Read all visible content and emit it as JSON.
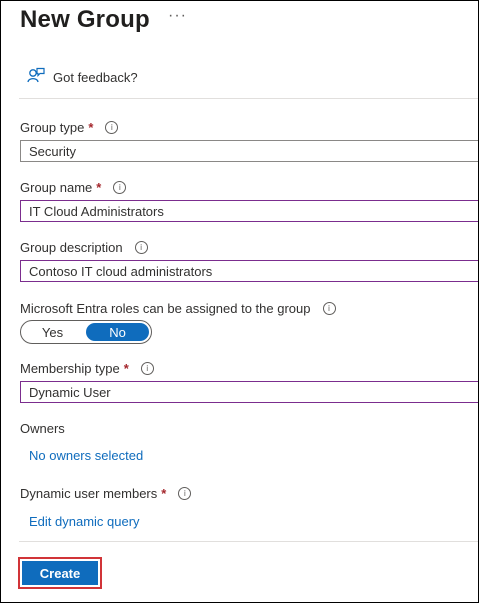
{
  "header": {
    "title": "New Group",
    "more_label": "···"
  },
  "feedback": {
    "label": "Got feedback?",
    "icon": "feedback-icon"
  },
  "form": {
    "group_type": {
      "label": "Group type",
      "required": "*",
      "value": "Security"
    },
    "group_name": {
      "label": "Group name",
      "required": "*",
      "value": "IT Cloud Administrators"
    },
    "group_description": {
      "label": "Group description",
      "value": "Contoso IT cloud administrators"
    },
    "entra_roles": {
      "label": "Microsoft Entra roles can be assigned to the group",
      "options": [
        "Yes",
        "No"
      ],
      "selected": "No"
    },
    "membership_type": {
      "label": "Membership type",
      "required": "*",
      "value": "Dynamic User"
    },
    "owners": {
      "label": "Owners",
      "link": "No owners selected"
    },
    "dynamic_members": {
      "label": "Dynamic user members",
      "required": "*",
      "link": "Edit dynamic query"
    }
  },
  "footer": {
    "create_label": "Create"
  },
  "colors": {
    "accent": "#0f6cbd",
    "required": "#a4262c",
    "highlight_border": "#d13438",
    "field_focus_border": "#7b2d8e"
  },
  "info_icon_glyph": "i"
}
